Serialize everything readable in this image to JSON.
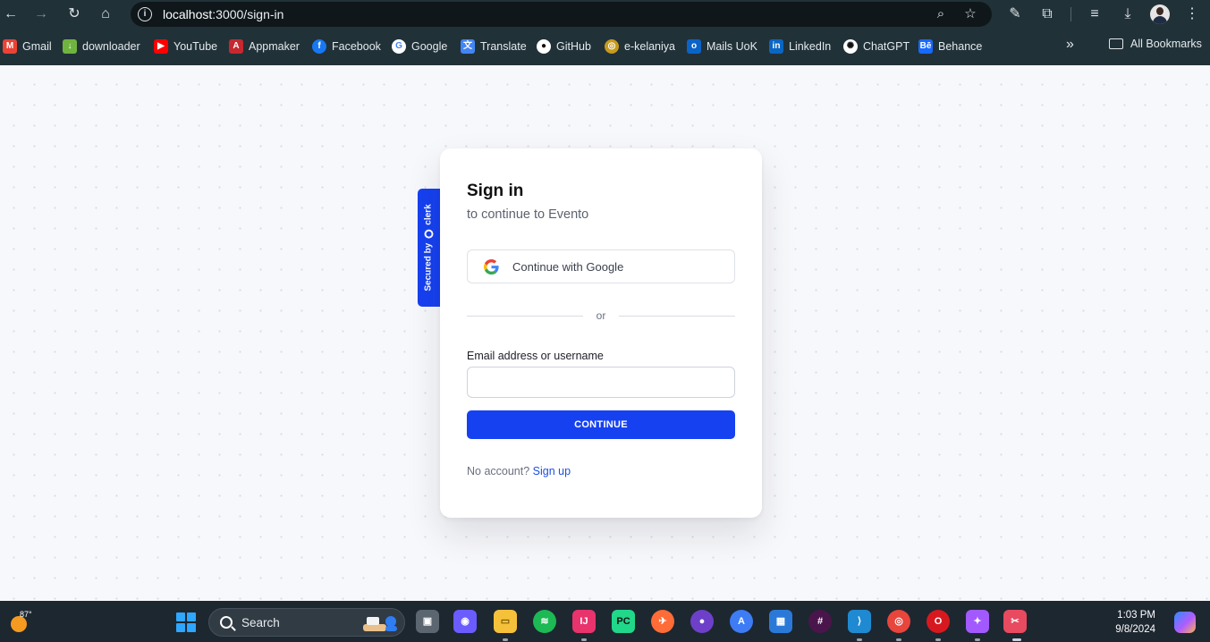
{
  "browser": {
    "url_host": "localhost",
    "url_path": ":3000/sign-in",
    "bookmarks": [
      {
        "label": "Gmail",
        "icon": "gmail-icon"
      },
      {
        "label": "downloader",
        "icon": "download-icon"
      },
      {
        "label": "YouTube",
        "icon": "youtube-icon"
      },
      {
        "label": "Appmaker",
        "icon": "appmaker-icon"
      },
      {
        "label": "Facebook",
        "icon": "facebook-icon"
      },
      {
        "label": "Google",
        "icon": "google-icon"
      },
      {
        "label": "Translate",
        "icon": "translate-icon"
      },
      {
        "label": "GitHub",
        "icon": "github-icon"
      },
      {
        "label": "e-kelaniya",
        "icon": "kelaniya-icon"
      },
      {
        "label": "Mails UoK",
        "icon": "outlook-icon"
      },
      {
        "label": "LinkedIn",
        "icon": "linkedin-icon"
      },
      {
        "label": "ChatGPT",
        "icon": "chatgpt-icon"
      },
      {
        "label": "Behance",
        "icon": "behance-icon"
      }
    ],
    "all_bookmarks": "All Bookmarks"
  },
  "signin": {
    "title": "Sign in",
    "subtitle": "to continue to Evento",
    "google_label": "Continue with Google",
    "divider": "or",
    "email_label": "Email address or username",
    "email_value": "",
    "continue_label": "CONTINUE",
    "no_account": "No account?",
    "signup_label": "Sign up",
    "secured_by": "Secured by",
    "brand": "clerk"
  },
  "taskbar": {
    "temperature": "87°",
    "search_label": "Search",
    "time": "1:03 PM",
    "date": "9/8/2024",
    "apps": [
      {
        "icon": "task-view-icon",
        "color": "#5b6670"
      },
      {
        "icon": "meet-icon",
        "color": "#6b5cff"
      },
      {
        "icon": "file-explorer-icon",
        "color": "#f6c13a"
      },
      {
        "icon": "spotify-icon",
        "color": "#1db954"
      },
      {
        "icon": "intellij-icon",
        "color": "#e8336d"
      },
      {
        "icon": "pycharm-icon",
        "color": "#21d789"
      },
      {
        "icon": "postman-icon",
        "color": "#ff6c37"
      },
      {
        "icon": "github-desktop-icon",
        "color": "#6e40c9"
      },
      {
        "icon": "app-store-icon",
        "color": "#3d7cf5"
      },
      {
        "icon": "microsoft-store-icon",
        "color": "#2a79d8"
      },
      {
        "icon": "slack-icon",
        "color": "#4a154b"
      },
      {
        "icon": "vscode-icon",
        "color": "#1f8ad2"
      },
      {
        "icon": "chrome-icon",
        "color": "#e8453c"
      },
      {
        "icon": "opera-icon",
        "color": "#d8181f"
      },
      {
        "icon": "figma-icon",
        "color": "#a259ff"
      },
      {
        "icon": "snipping-tool-icon",
        "color": "#e84a5f"
      }
    ]
  }
}
